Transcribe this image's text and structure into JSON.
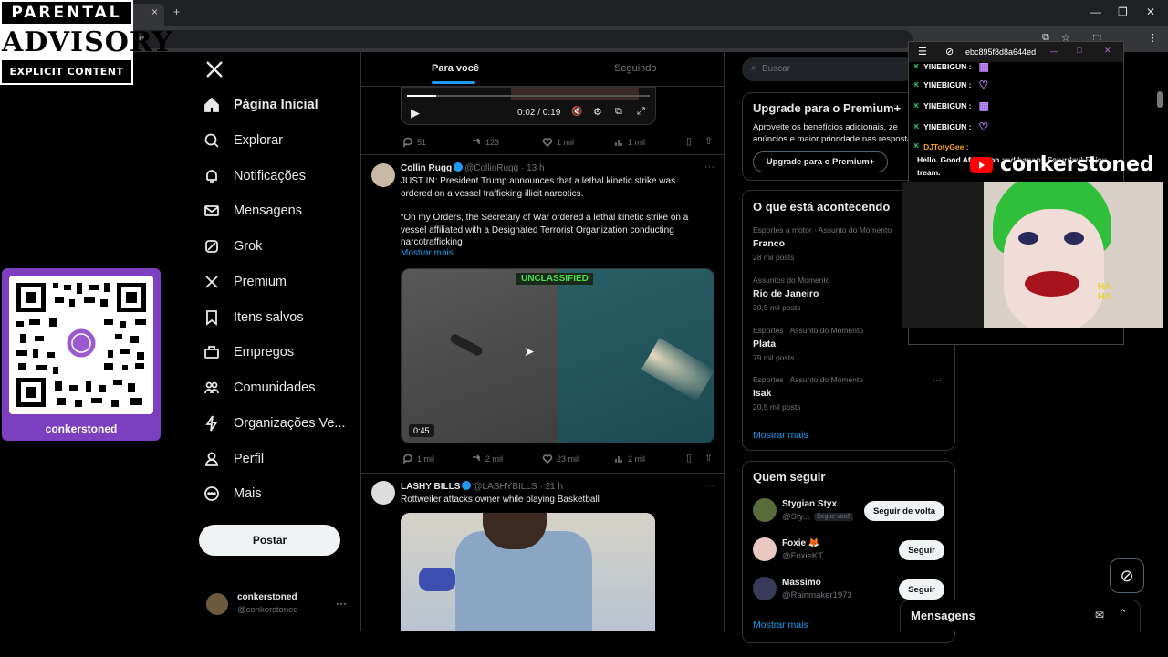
{
  "browser": {
    "url_fragment": "ne",
    "close_tab": "×",
    "new_tab": "+"
  },
  "advisory": {
    "line1": "PARENTAL",
    "line2": "ADVISORY",
    "line3": "EXPLICIT CONTENT"
  },
  "qr": {
    "label": "conkerstoned"
  },
  "nav": {
    "items": [
      {
        "label": "Página Inicial",
        "icon": "home-icon"
      },
      {
        "label": "Explorar",
        "icon": "search-icon"
      },
      {
        "label": "Notificações",
        "icon": "bell-icon"
      },
      {
        "label": "Mensagens",
        "icon": "mail-icon"
      },
      {
        "label": "Grok",
        "icon": "grok-icon"
      },
      {
        "label": "Premium",
        "icon": "x-icon"
      },
      {
        "label": "Itens salvos",
        "icon": "bookmark-icon"
      },
      {
        "label": "Empregos",
        "icon": "briefcase-icon"
      },
      {
        "label": "Comunidades",
        "icon": "people-icon"
      },
      {
        "label": "Organizações Ve...",
        "icon": "lightning-icon"
      },
      {
        "label": "Perfil",
        "icon": "person-icon"
      },
      {
        "label": "Mais",
        "icon": "more-circle-icon"
      }
    ],
    "post_label": "Postar"
  },
  "profile": {
    "name": "conkerstoned",
    "handle": "@conkerstoned"
  },
  "feed": {
    "tabs": [
      "Para você",
      "Seguindo"
    ],
    "video_controls": {
      "time": "0:02 / 0:19"
    },
    "tweet0_stats": [
      "51",
      "123",
      "1 mil",
      "1 mil"
    ],
    "tweet1": {
      "name": "Collin Rugg",
      "handle": "@CollinRugg · 13 h",
      "text1": "JUST IN: President Trump announces that a lethal kinetic strike was ordered on a vessel trafficking illicit narcotics.",
      "text2": "“On my Orders, the Secretary of War ordered a lethal kinetic strike on a vessel affiliated with a Designated Terrorist Organization conducting narcotrafficking",
      "more": "Mostrar mais",
      "media_badge": "UNCLASSIFIED",
      "duration": "0:45",
      "stats": [
        "1 mil",
        "2 mil",
        "23 mil",
        "2 mil"
      ]
    },
    "tweet2": {
      "name": "LASHY BILLS",
      "handle": "@LASHYBILLS · 21 h",
      "text": "Rottweiler attacks owner while playing Basketball"
    }
  },
  "right": {
    "search_placeholder": "Buscar",
    "premium": {
      "title": "Upgrade para o Premium+",
      "desc1": "Aproveite os benefícios adicionais, ze",
      "desc2": "anúncios e maior prioridade nas respostas.",
      "button": "Upgrade para o Premium+"
    },
    "trends_title": "O que está acontecendo",
    "trends": [
      {
        "cat": "Esportes a motor · Assunto do Momento",
        "name": "Franco",
        "count": "28 mil posts"
      },
      {
        "cat": "Assuntos do Momento",
        "name": "Rio de Janeiro",
        "count": "30,5 mil posts"
      },
      {
        "cat": "Esportes · Assunto do Momento",
        "name": "Plata",
        "count": "79 mil posts"
      },
      {
        "cat": "Esportes · Assunto do Momento",
        "name": "Isak",
        "count": "20,5 mil posts"
      }
    ],
    "trends_more": "Mostrar mais",
    "follow_title": "Quem seguir",
    "follow": [
      {
        "name": "Stygian Styx",
        "handle": "@Sty...",
        "badge": "Segue você",
        "button": "Seguir de volta"
      },
      {
        "name": "Foxie 🦊",
        "handle": "@FoxieKT",
        "button": "Seguir"
      },
      {
        "name": "Massimo",
        "handle": "@Rainmaker1973",
        "button": "Seguir"
      }
    ],
    "follow_more": "Mostrar mais",
    "messages": "Mensagens"
  },
  "chat": {
    "window_title": "ebc895f8d8a644ed",
    "lines": [
      {
        "user": "YINEBIGUN :"
      },
      {
        "user": "YINEBIGUN :"
      },
      {
        "user": "YINEBIGUN :"
      },
      {
        "user": "YINEBIGUN :"
      },
      {
        "user": "DJTotyGee :",
        "text": "Hello. Good Afternoon and hapopy Saturday! Enjoy ... tream."
      }
    ],
    "channel": "conkerstoned"
  }
}
